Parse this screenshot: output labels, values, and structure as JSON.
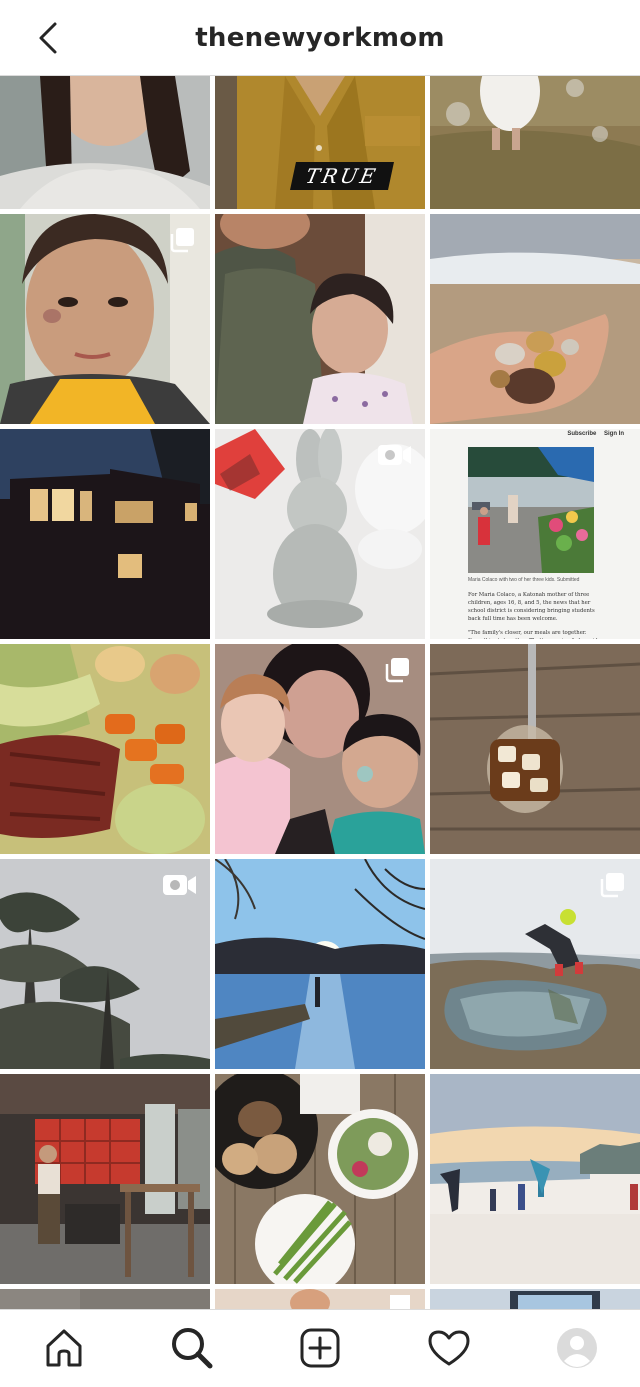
{
  "header": {
    "username": "thenewyorkmom",
    "back_icon": "chevron-left-icon"
  },
  "posts": [
    {
      "id": "p1",
      "subject": "woman selfie in grey sweater"
    },
    {
      "id": "p2",
      "subject": "mustard shirt",
      "overlay_text": "TRUE"
    },
    {
      "id": "p3",
      "subject": "child blowing bubbles on lawn"
    },
    {
      "id": "p4",
      "subject": "boy portrait",
      "badge": "carousel-icon"
    },
    {
      "id": "p5",
      "subject": "mother and daughter"
    },
    {
      "id": "p6",
      "subject": "hand holding beach stones"
    },
    {
      "id": "p7",
      "subject": "house at dusk"
    },
    {
      "id": "p8",
      "subject": "ceramic bunny",
      "badge": "video-icon"
    },
    {
      "id": "p9",
      "subject": "news article screenshot",
      "article": {
        "nav": [
          "Subscribe",
          "Sign In"
        ],
        "caption": "Maria Colaco with two of her three kids. Submitted",
        "paragraphs": [
          "For Maria Colaco, a Katonah mother of three children, ages 16, 8, and 5, the news that her school district is considering bringing students back full time has been welcome.",
          "\"The family's closer, our meals are together. Everything's together. That's amazing,\" she said. \"And"
        ]
      }
    },
    {
      "id": "p10",
      "subject": "corned beef and cabbage"
    },
    {
      "id": "p11",
      "subject": "family selfie with face paint",
      "badge": "carousel-icon"
    },
    {
      "id": "p12",
      "subject": "cold brew jar with straw"
    },
    {
      "id": "p13",
      "subject": "trees against grey sky",
      "badge": "video-icon"
    },
    {
      "id": "p14",
      "subject": "lake at sunset"
    },
    {
      "id": "p15",
      "subject": "boy in tide pool",
      "badge": "carousel-icon"
    },
    {
      "id": "p16",
      "subject": "red lockers in workshop"
    },
    {
      "id": "p17",
      "subject": "dinner plates from above"
    },
    {
      "id": "p18",
      "subject": "kids cartwheeling on beach"
    },
    {
      "id": "p19",
      "subject": "partial row"
    },
    {
      "id": "p20",
      "subject": "partial row"
    },
    {
      "id": "p21",
      "subject": "partial row"
    }
  ],
  "tabbar": {
    "items": [
      {
        "name": "home",
        "icon": "home-icon"
      },
      {
        "name": "search",
        "icon": "search-icon",
        "active": true
      },
      {
        "name": "new-post",
        "icon": "add-post-icon"
      },
      {
        "name": "activity",
        "icon": "heart-icon"
      },
      {
        "name": "profile",
        "icon": "profile-avatar-icon"
      }
    ]
  },
  "colors": {
    "text": "#262626",
    "border": "#dbdbdb",
    "background": "#ffffff"
  }
}
